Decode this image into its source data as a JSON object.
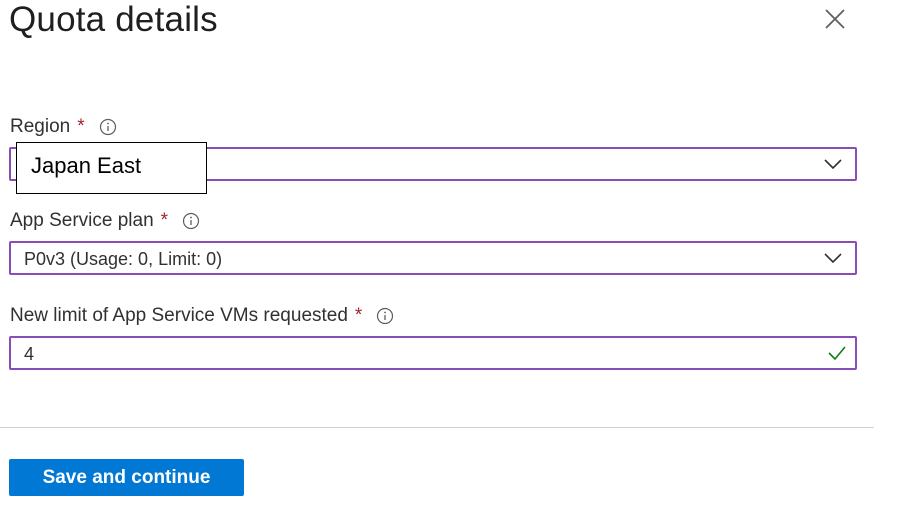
{
  "panel": {
    "title": "Quota details",
    "close_icon": "close-icon"
  },
  "region": {
    "label": "Region",
    "required_marker": "*",
    "value": "Japan East"
  },
  "app_service_plan": {
    "label": "App Service plan",
    "required_marker": "*",
    "value": "P0v3 (Usage: 0, Limit: 0)"
  },
  "new_limit": {
    "label": "New limit of App Service VMs requested",
    "required_marker": "*",
    "value": "4"
  },
  "footer": {
    "save_label": "Save and continue"
  },
  "colors": {
    "accent_border": "#8a4db8",
    "primary_button": "#0078d4",
    "required": "#a4262c",
    "valid_check": "#107c10"
  }
}
